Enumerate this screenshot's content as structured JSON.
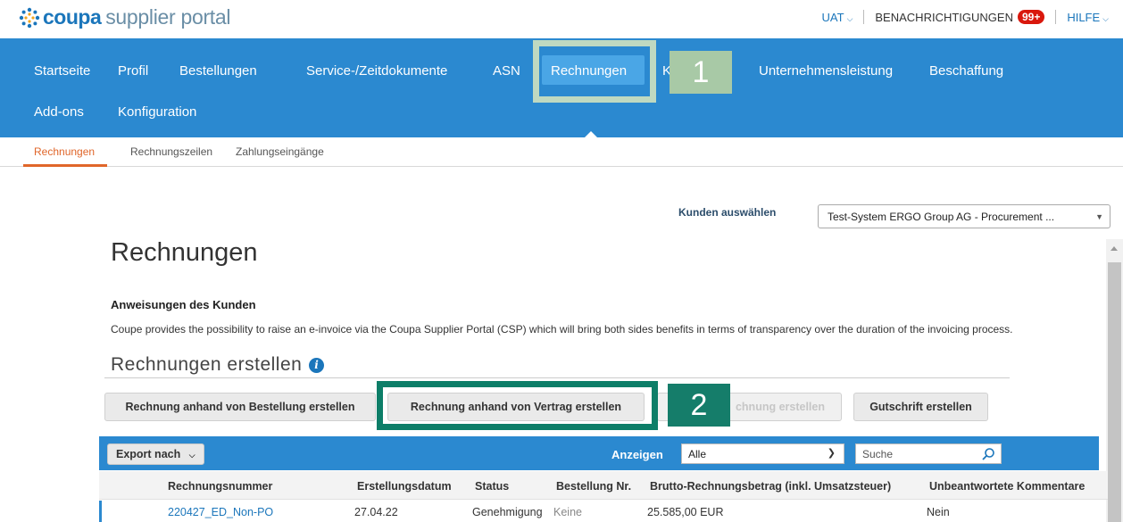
{
  "brand": {
    "name": "coupa",
    "rest": "supplier portal"
  },
  "top_links": {
    "env": "UAT",
    "notifications": "BENACHRICHTIGUNGEN",
    "badge": "99+",
    "help": "HILFE"
  },
  "nav": {
    "row1": [
      "Startseite",
      "Profil",
      "Bestellungen",
      "Service-/Zeitdokumente",
      "ASN",
      "Rechnungen",
      "K",
      "Unternehmensleistung",
      "Beschaffung"
    ],
    "row2": [
      "Add-ons",
      "Konfiguration"
    ]
  },
  "subnav": [
    "Rechnungen",
    "Rechnungszeilen",
    "Zahlungseingänge"
  ],
  "callouts": [
    "1",
    "2"
  ],
  "customer": {
    "label": "Kunden auswählen",
    "value": "Test-System ERGO Group AG - Procurement ..."
  },
  "page": {
    "title": "Rechnungen",
    "instructions_title": "Anweisungen des Kunden",
    "instructions_text": "Coupe provides the possibility to raise an e-invoice via the Coupa Supplier Portal (CSP) which will bring both sides benefits in terms of transparency over the duration of the invoicing process.",
    "create_title": "Rechnungen erstellen"
  },
  "buttons": {
    "from_po": "Rechnung anhand von Bestellung erstellen",
    "from_contract": "Rechnung anhand von Vertrag erstellen",
    "blank_partial": "chnung erstellen",
    "credit_note": "Gutschrift erstellen"
  },
  "toolbar": {
    "export": "Export nach",
    "show_label": "Anzeigen",
    "filter": "Alle",
    "search_placeholder": "Suche"
  },
  "table": {
    "headers": [
      "Rechnungsnummer",
      "Erstellungsdatum",
      "Status",
      "Bestellung Nr.",
      "Brutto-Rechnungsbetrag (inkl. Umsatzsteuer)",
      "Unbeantwortete Kommentare"
    ],
    "rows": [
      [
        "220427_ED_Non-PO",
        "27.04.22",
        "Genehmigung",
        "Keine",
        "25.585,00 EUR",
        "Nein"
      ]
    ]
  }
}
